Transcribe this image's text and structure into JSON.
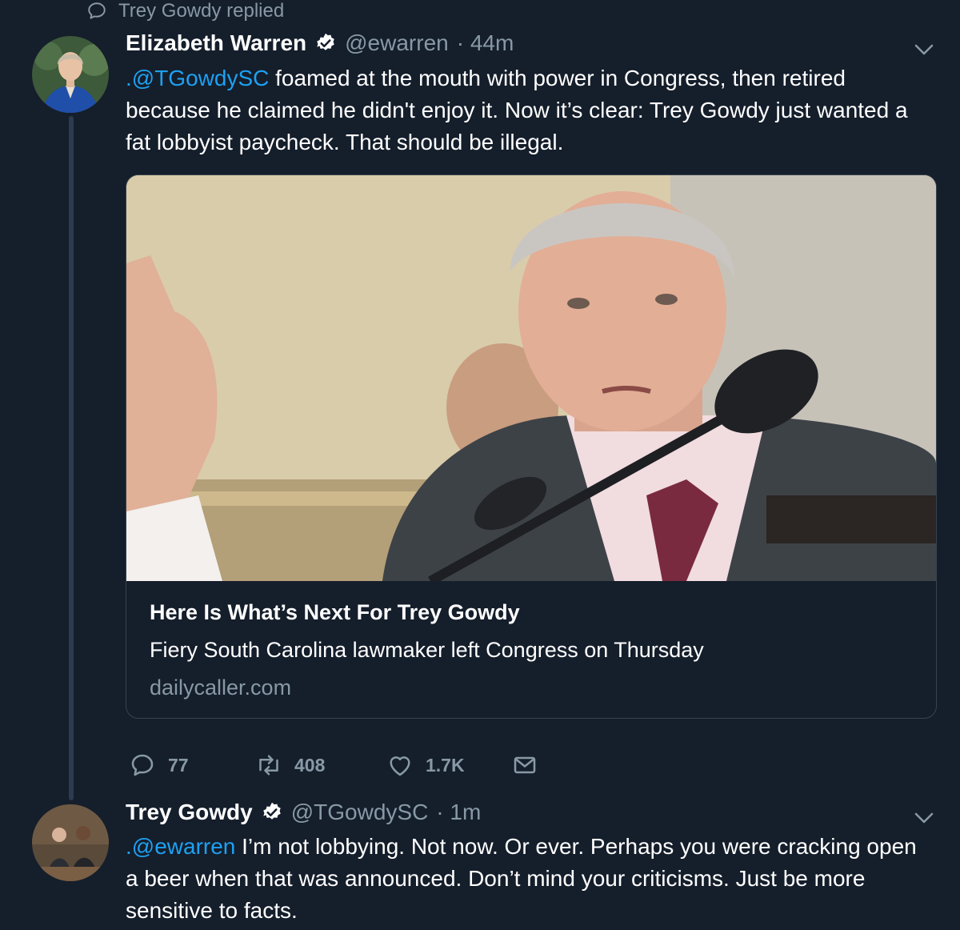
{
  "context": {
    "icon": "reply-bubble-icon",
    "text": "Trey Gowdy replied"
  },
  "tweet1": {
    "name": "Elizabeth Warren",
    "handle": "@ewarren",
    "time": "· 44m",
    "mention": ".@TGowdySC",
    "text": " foamed at the mouth with power in Congress, then retired because he claimed he didn't enjoy it. Now it’s clear: Trey Gowdy just wanted a fat lobbyist paycheck. That should be illegal.",
    "card": {
      "title": "Here Is What’s Next For Trey Gowdy",
      "description": "Fiery South Carolina lawmaker left Congress on Thursday",
      "domain": "dailycaller.com"
    },
    "actions": {
      "replies": "77",
      "retweets": "408",
      "likes": "1.7K"
    }
  },
  "tweet2": {
    "name": "Trey Gowdy",
    "handle": "@TGowdySC",
    "time": "· 1m",
    "mention": ".@ewarren",
    "text": " I’m not lobbying. Not now. Or ever. Perhaps you were cracking open a beer when that was announced. Don’t mind your criticisms. Just be more sensitive to facts."
  },
  "colors": {
    "background": "#151e2b",
    "link": "#1da1f2",
    "secondary": "#8899a6",
    "border": "#38444d"
  }
}
